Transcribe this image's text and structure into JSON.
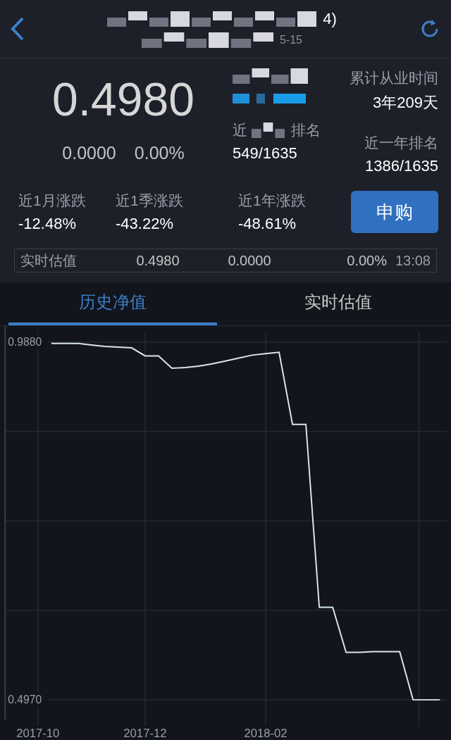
{
  "nav": {
    "title_tail": "4)",
    "subtitle_tail": "5-15"
  },
  "summary": {
    "nav_value": "0.4980",
    "change": "0.0000",
    "change_pct": "0.00%",
    "rank_label_head": "近",
    "rank_label_tail": "排名",
    "rank_value": "549/1635",
    "tenure_label": "累计从业时间",
    "tenure_value": "3年209天",
    "year_rank_label": "近一年排名",
    "year_rank_value": "1386/1635"
  },
  "returns": [
    {
      "label": "近1月涨跌",
      "value": "-12.48%"
    },
    {
      "label": "近1季涨跌",
      "value": "-43.22%"
    },
    {
      "label": "近1年涨跌",
      "value": "-48.61%"
    }
  ],
  "buy_button": "申购",
  "estimate": {
    "label": "实时估值",
    "value": "0.4980",
    "change": "0.0000",
    "change_pct": "0.00%",
    "time": "13:08"
  },
  "tabs": [
    {
      "label": "历史净值",
      "selected": true
    },
    {
      "label": "实时估值",
      "selected": false
    }
  ],
  "chart": {
    "chart_data": {
      "type": "line",
      "categories": [
        null,
        null,
        "2017-10",
        null,
        null,
        null,
        null,
        null,
        null,
        null,
        "2017-12",
        null,
        null,
        null,
        null,
        null,
        null,
        null,
        null,
        "2018-02",
        null,
        null,
        null,
        null,
        null,
        null,
        null,
        null,
        null,
        null,
        null,
        null,
        null
      ],
      "series": [
        {
          "color": "#d8e6f2",
          "values": [
            null,
            null,
            null,
            0.986,
            0.986,
            0.986,
            0.984,
            0.982,
            0.981,
            0.98,
            0.969,
            0.969,
            0.952,
            0.953,
            0.955,
            0.958,
            0.962,
            0.966,
            0.97,
            0.972,
            0.974,
            0.875,
            0.875,
            0.624,
            0.624,
            0.562,
            0.562,
            0.563,
            0.563,
            0.563,
            0.497,
            0.497,
            0.497
          ]
        }
      ],
      "ylim": [
        0.47,
        1.01
      ],
      "grid": true,
      "yticks": [
        {
          "value": 0.988,
          "label": "0.9880"
        },
        {
          "value": 0.497,
          "label": "0.4970"
        }
      ]
    }
  }
}
